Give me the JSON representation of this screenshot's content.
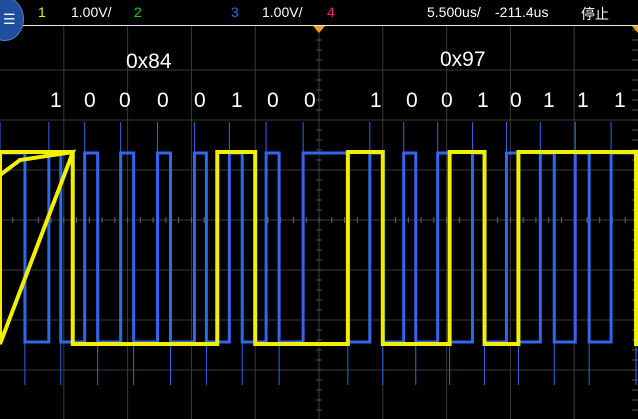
{
  "header": {
    "ch1_label": "1",
    "ch1_scale": "1.00V/",
    "ch2_label": "2",
    "ch3_label": "3",
    "ch3_scale": "1.00V/",
    "ch4_label": "4",
    "timebase": "5.500us/",
    "delay": "-211.4us",
    "run_state": "停止"
  },
  "colors": {
    "ch1": "#f0f000",
    "ch2": "#22cc22",
    "ch3": "#3366ee",
    "ch4": "#ff2277",
    "trigger": "#f0a020",
    "grid": "#3a3a3a"
  },
  "menu_icon": "menu-icon",
  "chart_data": {
    "type": "line",
    "title": "",
    "xlabel": "",
    "ylabel": "",
    "xlim_us": [
      -238.9,
      -183.9
    ],
    "x_divisions": 10,
    "y_divisions": 8,
    "grid": true,
    "annotations": [
      {
        "text": "0x84",
        "bits": [
          "1",
          "0",
          "0",
          "0",
          "0",
          "1",
          "0",
          "0"
        ]
      },
      {
        "text": "0x97",
        "bits": [
          "1",
          "0",
          "0",
          "1",
          "0",
          "1",
          "1",
          "1"
        ]
      }
    ],
    "series": [
      {
        "channel": "1",
        "color": "#f0f000",
        "logic_high_intervals_us": [
          [
            -238.9,
            -232.63
          ],
          [
            -220.17,
            -216.9
          ],
          [
            -208.91,
            -205.9
          ],
          [
            -200.14,
            -197.13
          ],
          [
            -194.21,
            -184.07
          ]
        ]
      },
      {
        "channel": "3",
        "color": "#3366ee",
        "logic_high_intervals_us": [
          [
            -238.9,
            -236.75
          ],
          [
            -234.69,
            -233.66
          ],
          [
            -231.6,
            -230.48
          ],
          [
            -228.5,
            -227.38
          ],
          [
            -225.32,
            -224.2
          ],
          [
            -222.14,
            -221.11
          ],
          [
            -219.13,
            -218.02
          ],
          [
            -215.96,
            -214.84
          ],
          [
            -212.77,
            -208.91
          ],
          [
            -207.02,
            -205.9
          ],
          [
            -204.1,
            -203.06
          ],
          [
            -201.17,
            -200.14
          ],
          [
            -198.17,
            -197.13
          ],
          [
            -195.24,
            -194.21
          ],
          [
            -192.32,
            -191.12
          ],
          [
            -189.31,
            -188.11
          ],
          [
            -186.22,
            -184.07
          ]
        ]
      }
    ]
  }
}
